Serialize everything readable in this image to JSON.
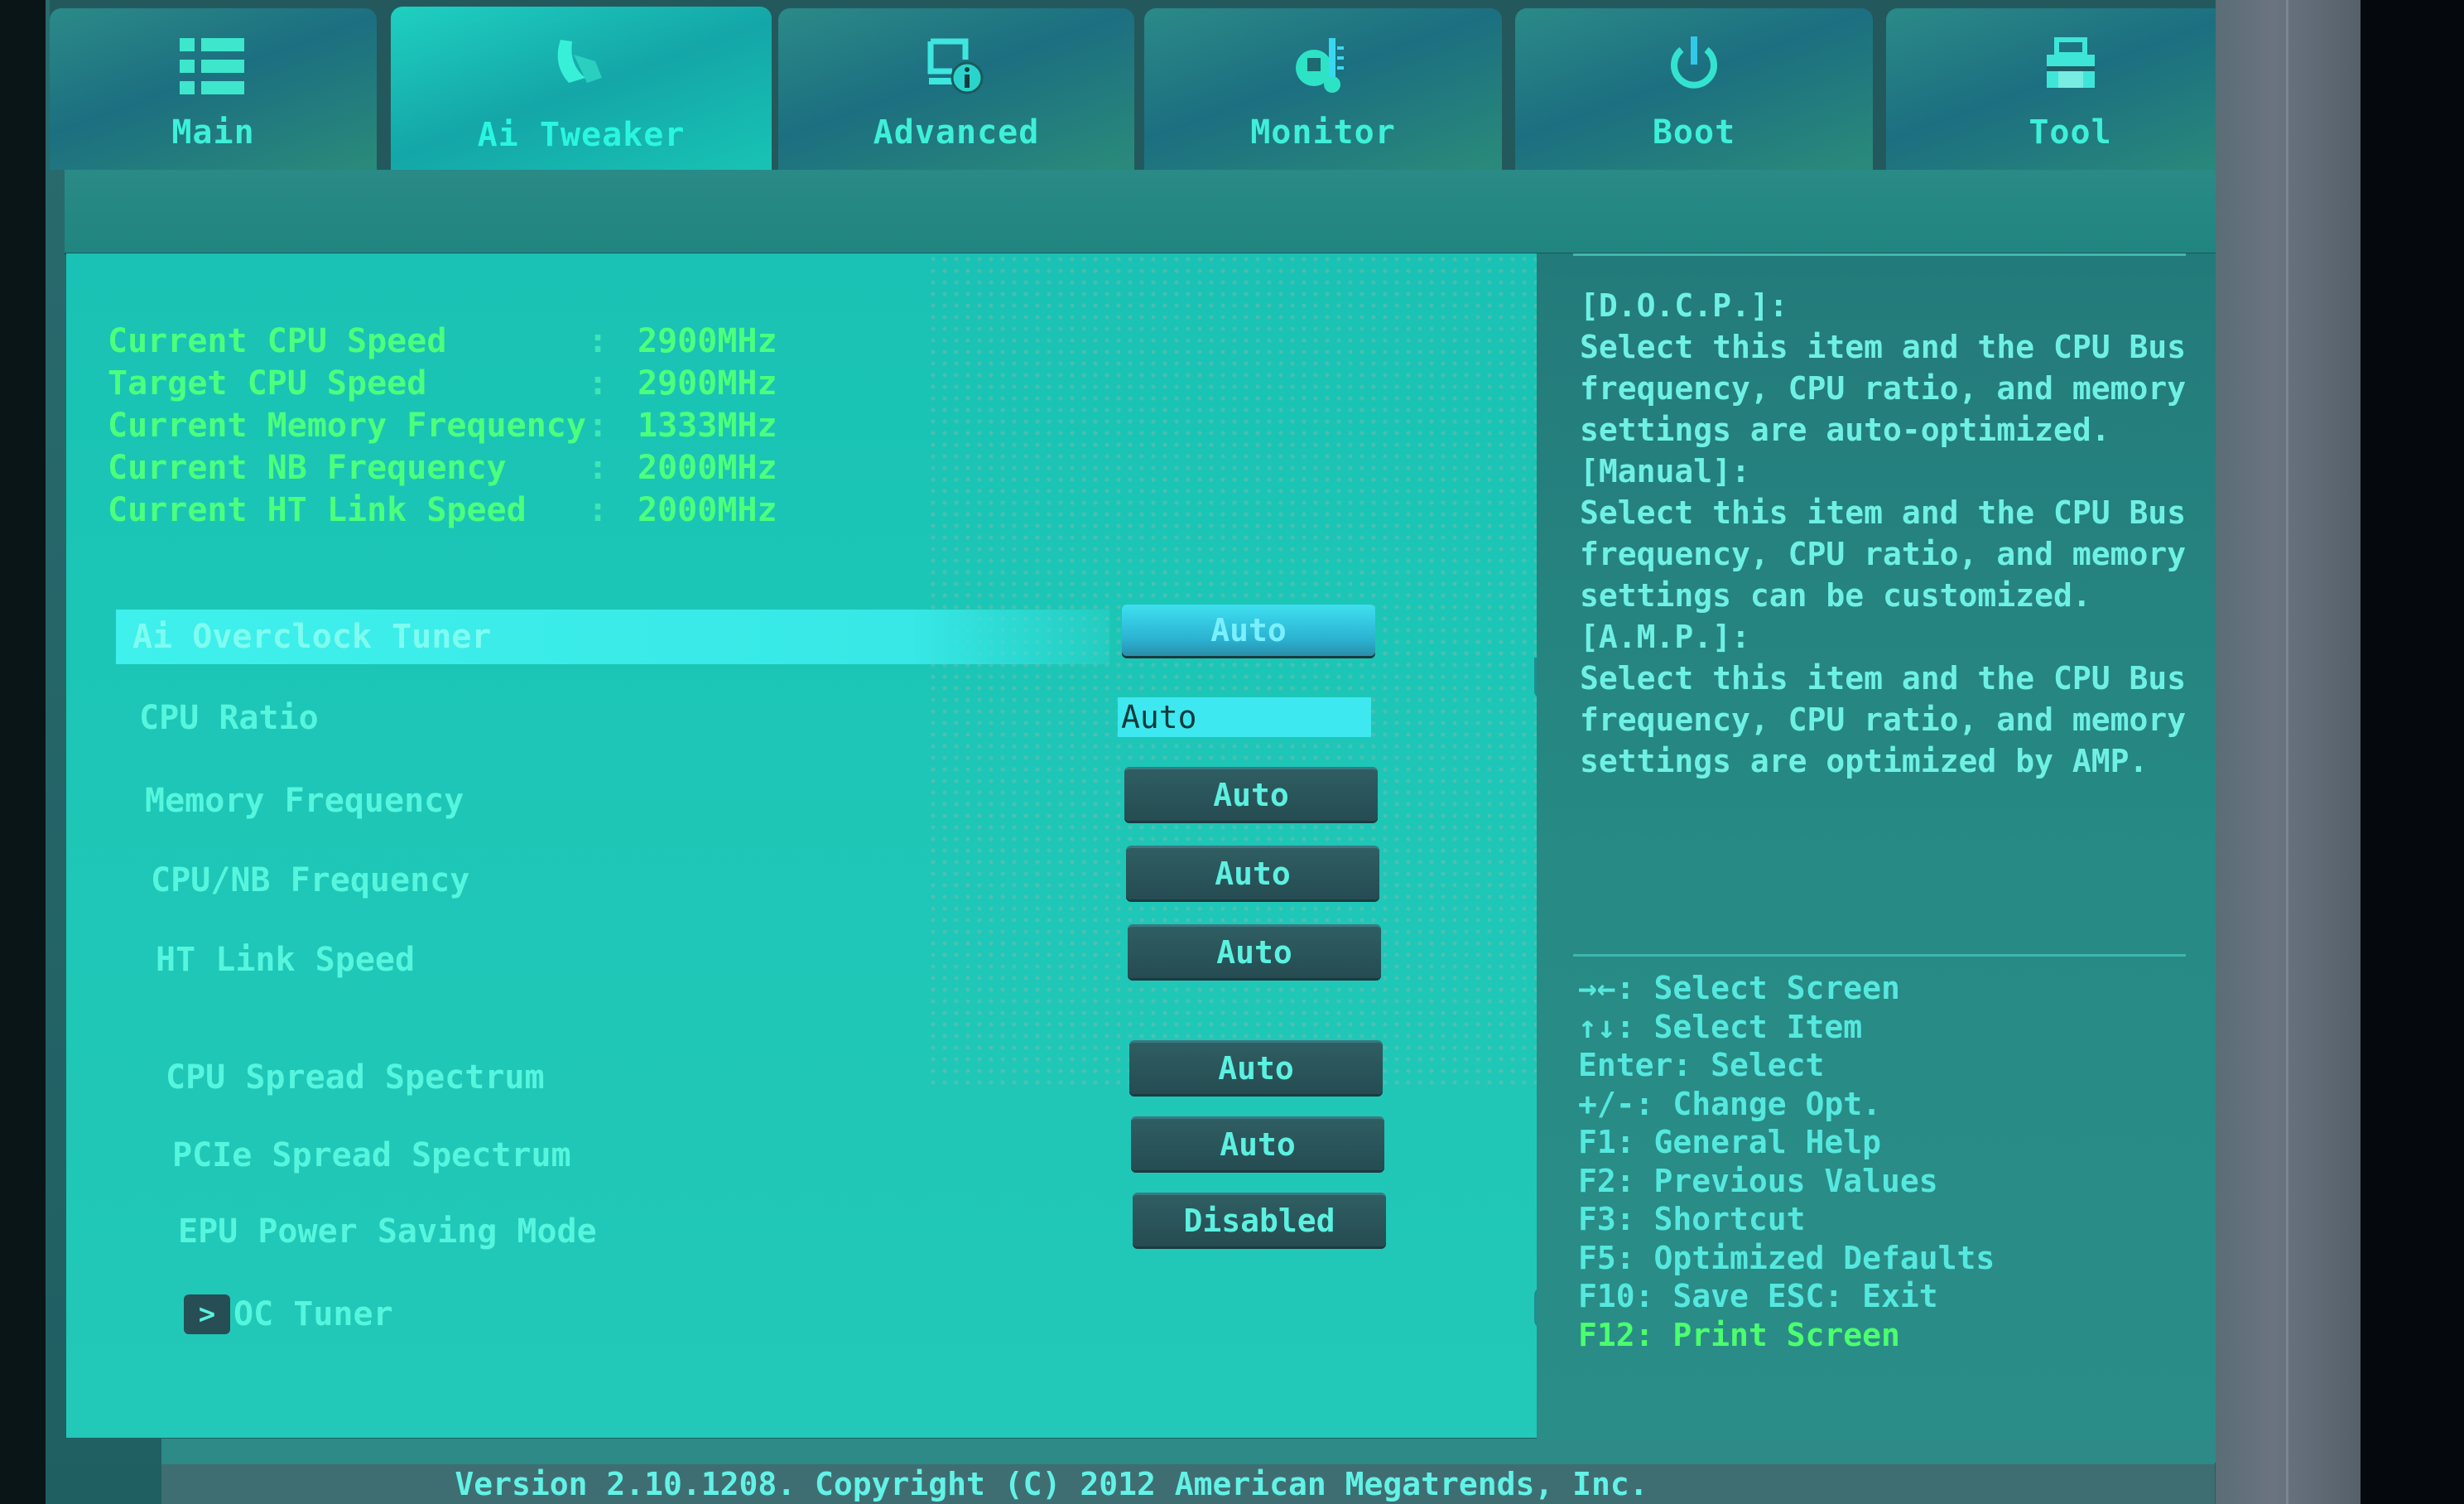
{
  "tabs": [
    {
      "label": "Main",
      "icon": "list-icon",
      "active": false
    },
    {
      "label": "Ai Tweaker",
      "icon": "tweaker-icon",
      "active": true
    },
    {
      "label": "Advanced",
      "icon": "advanced-info-icon",
      "active": false
    },
    {
      "label": "Monitor",
      "icon": "thermometer-icon",
      "active": false
    },
    {
      "label": "Boot",
      "icon": "power-icon",
      "active": false
    },
    {
      "label": "Tool",
      "icon": "toolbox-icon",
      "active": false
    }
  ],
  "info": [
    {
      "label": "Current CPU Speed",
      "sep": ":",
      "value": "2900MHz"
    },
    {
      "label": "Target CPU Speed",
      "sep": ":",
      "value": "2900MHz"
    },
    {
      "label": "Current Memory Frequency",
      "sep": ":",
      "value": "1333MHz"
    },
    {
      "label": "Current NB Frequency",
      "sep": ":",
      "value": "2000MHz"
    },
    {
      "label": "Current HT Link Speed",
      "sep": ":",
      "value": "2000MHz"
    }
  ],
  "settings": [
    {
      "label": "Ai Overclock Tuner",
      "value": "Auto",
      "selected": true
    },
    {
      "label": "CPU Ratio",
      "value": "Auto",
      "type": "input"
    },
    {
      "label": "Memory Frequency",
      "value": "Auto"
    },
    {
      "label": "CPU/NB Frequency",
      "value": "Auto"
    },
    {
      "label": "HT Link Speed",
      "value": "Auto"
    },
    {
      "label": "CPU Spread Spectrum",
      "value": "Auto"
    },
    {
      "label": "PCIe Spread Spectrum",
      "value": "Auto"
    },
    {
      "label": "EPU Power Saving Mode",
      "value": "Disabled"
    },
    {
      "label": "OC Tuner",
      "type": "submenu"
    }
  ],
  "scrollbar": {
    "position_fraction": 0.0,
    "visible_fraction": 0.55
  },
  "help": {
    "lines": [
      "[D.O.C.P.]:",
      "Select this item and the CPU Bus",
      "frequency, CPU ratio, and memory",
      "settings are auto-optimized.",
      "[Manual]:",
      "Select this item and the CPU Bus",
      "frequency, CPU ratio, and memory",
      "settings can be customized.",
      "[A.M.P.]:",
      "Select this item and the CPU Bus",
      "frequency, CPU ratio, and memory",
      "settings are optimized by AMP."
    ]
  },
  "keys": [
    "→←: Select Screen",
    "↑↓: Select Item",
    "Enter: Select",
    "+/-: Change Opt.",
    "F1: General Help",
    "F2: Previous Values",
    "F3: Shortcut",
    "F5: Optimized Defaults",
    "F10: Save  ESC: Exit",
    "F12: Print Screen"
  ],
  "footer": "Version 2.10.1208. Copyright (C) 2012 American Megatrends, Inc.",
  "colors": {
    "accent_green": "#4cff7c",
    "text_cyan": "#56f5de",
    "panel": "#1cc6b6"
  }
}
